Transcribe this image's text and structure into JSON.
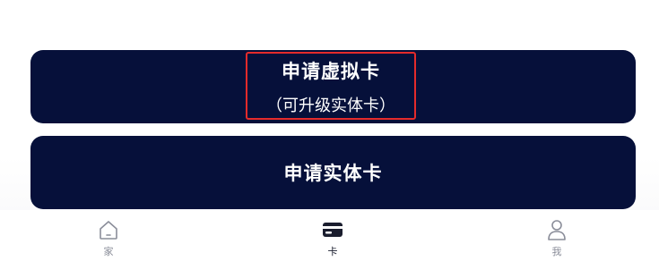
{
  "buttons": {
    "virtual_card": {
      "title": "申请虚拟卡",
      "subtitle": "（可升级实体卡）"
    },
    "physical_card": {
      "title": "申请实体卡"
    }
  },
  "tabbar": {
    "items": [
      {
        "label": "家",
        "icon": "home-icon",
        "active": false
      },
      {
        "label": "卡",
        "icon": "card-icon",
        "active": true
      },
      {
        "label": "我",
        "icon": "user-icon",
        "active": false
      }
    ]
  },
  "colors": {
    "button_bg": "#06103a",
    "highlight_border": "#e52b2b",
    "tab_inactive": "#8a8d99",
    "tab_active": "#1a1d2e"
  }
}
